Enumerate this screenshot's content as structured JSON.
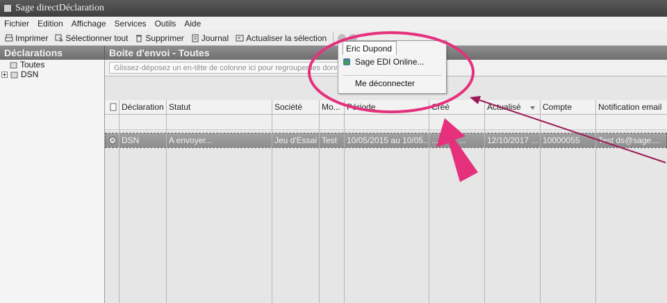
{
  "window": {
    "title": "Sage directDéclaration"
  },
  "menu": [
    "Fichier",
    "Edition",
    "Affichage",
    "Services",
    "Outils",
    "Aide"
  ],
  "toolbar": {
    "print": "Imprimer",
    "select_all": "Sélectionner tout",
    "delete": "Supprimer",
    "journal": "Journal",
    "refresh": "Actualiser la sélection"
  },
  "user_menu": {
    "user": "Eric Dupond",
    "items": [
      "Sage EDI Online...",
      "Me déconnecter"
    ]
  },
  "left_panel": {
    "title": "Déclarations",
    "tree": [
      "Toutes",
      "DSN"
    ]
  },
  "main": {
    "title": "Boite d'envoi - Toutes",
    "group_hint": "Glissez-déposez un en-tête de colonne ici pour regrouper les donné",
    "columns": [
      "Déclaration",
      "Statut",
      "Société",
      "Mo...",
      "Période",
      "Créé",
      "Actualisé",
      "Compte",
      "Notification email"
    ],
    "rows": [
      [
        "DSN",
        "A envoyer...",
        "Jeu d'Essai",
        "Test",
        "10/05/2015 au 10/05...",
        "...2017 ...",
        "12/10/2017 ...",
        "10000055",
        "Test ds@sage...."
      ]
    ]
  },
  "colors": {
    "annotation": "#e5317c",
    "accent_arrow": "#9c1a55"
  }
}
